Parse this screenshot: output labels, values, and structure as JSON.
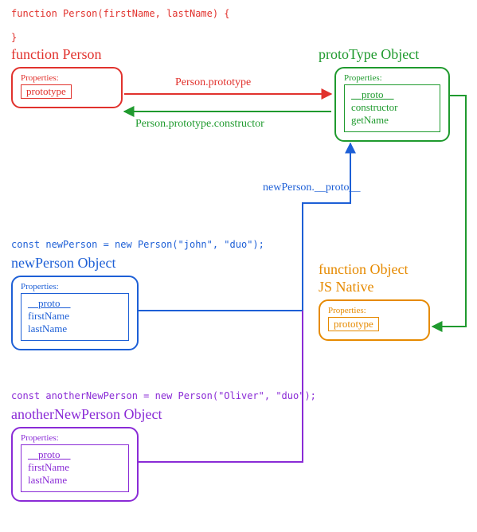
{
  "colors": {
    "red": "#e1322d",
    "green": "#1f9a2e",
    "blue": "#1d5fd6",
    "orange": "#e68a00",
    "purple": "#8a2bd6"
  },
  "code": {
    "funcDecl1": "function Person(firstName, lastName) {",
    "funcDecl2": "}",
    "newPerson": "const newPerson = new Person(\"john\", \"duo\");",
    "anotherNewPerson": "const anotherNewPerson = new Person(\"Oliver\", \"duo\");"
  },
  "titles": {
    "functionPerson": "function Person",
    "protoTypeObject": "protoType Object",
    "newPersonObject": "newPerson Object",
    "functionObject1": "function Object",
    "functionObject2": "JS Native",
    "anotherNewPersonObject": "anotherNewPerson Object"
  },
  "labels": {
    "properties": "Properties:",
    "prototype": "prototype",
    "proto": "__proto__",
    "constructor": "constructor",
    "getName": "getName",
    "firstName": "firstName",
    "lastName": "lastName"
  },
  "arrows": {
    "personPrototype": "Person.prototype",
    "personPrototypeConstructor": "Person.prototype.constructor",
    "newPersonProto": "newPerson.__proto__"
  }
}
